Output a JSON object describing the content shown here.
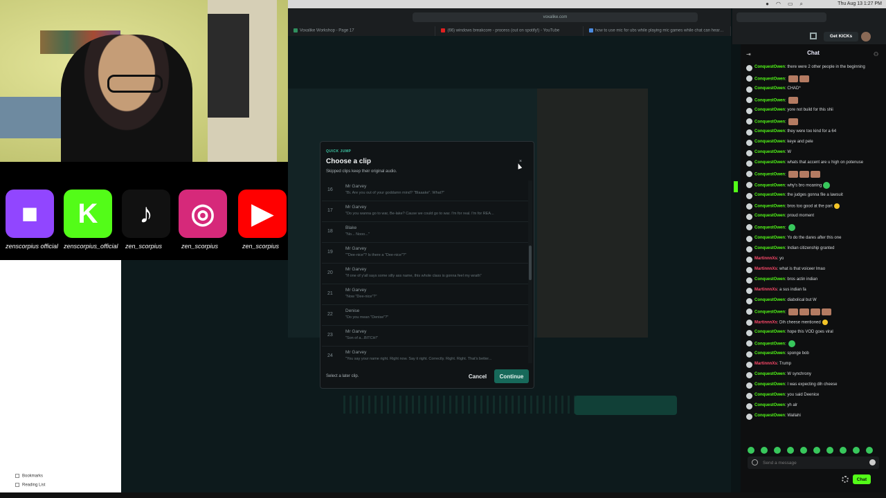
{
  "menubar": {
    "clock": "Thu Aug 13  1:27 PM"
  },
  "browser": {
    "url": "voxalike.com",
    "tabs": [
      {
        "label": "Voxalike Workshop - Page 17",
        "color": "#2f8f5e"
      },
      {
        "label": "(66) windows breakcore - process (out on spotify!) - YouTube",
        "color": "#e02020"
      },
      {
        "label": "how to use mic for ubs while playing mic games while chat can hear yo...",
        "color": "#4b8be0"
      }
    ]
  },
  "socials": [
    {
      "name": "twitch",
      "handle": "zenscorpius official",
      "color": "#9146ff",
      "glyph": "■"
    },
    {
      "name": "kick",
      "handle": "zenscorpius_official",
      "color": "#53fc18",
      "glyph": "K"
    },
    {
      "name": "tiktok",
      "handle": "zen_scorpius",
      "color": "#111",
      "glyph": "♪"
    },
    {
      "name": "instagram",
      "handle": "zen_scorpius",
      "color": "#d6297a",
      "glyph": "◎"
    },
    {
      "name": "youtube",
      "handle": "zen_scorpius",
      "color": "#ff0000",
      "glyph": "▶"
    }
  ],
  "sidebar": {
    "bookmarks": "Bookmarks",
    "reading_list": "Reading List"
  },
  "modal": {
    "kicker": "QUICK JUMP",
    "title": "Choose a clip",
    "subtitle": "Skipped clips keep their original audio.",
    "hint": "Select a later clip.",
    "cancel": "Cancel",
    "continue": "Continue",
    "clips": [
      {
        "num": "16",
        "speaker": "Mr Garvey",
        "line": "\"Bi. Are you out of your goddamn mind? \"Blaaake\". What?\""
      },
      {
        "num": "17",
        "speaker": "Mr Garvey",
        "line": "\"Do you wanna go to war, Be-lake? Cause we could go to war. I'm for real. I'm for REA..."
      },
      {
        "num": "18",
        "speaker": "Blake",
        "line": "\"No... Nooo...\""
      },
      {
        "num": "19",
        "speaker": "Mr Garvey",
        "line": "\"\"Dee-nice\"? Is there a \"Dee-nice\"?\""
      },
      {
        "num": "20",
        "speaker": "Mr Garvey",
        "line": "\"If one of y'all says some silly ass name, this whole class is gonna feel my wrath\""
      },
      {
        "num": "21",
        "speaker": "Mr Garvey",
        "line": "\"Now \"Dee-nice\"?\""
      },
      {
        "num": "22",
        "speaker": "Denise",
        "line": "\"Do you mean \"Denise\"?\""
      },
      {
        "num": "23",
        "speaker": "Mr Garvey",
        "line": "\"Son of a...BITCH!\""
      },
      {
        "num": "24",
        "speaker": "Mr Garvey",
        "line": "\"You say your name right. Right now. Say it right. Correctly. Right. Right. That's better..."
      }
    ]
  },
  "kick": {
    "get_kicks": "Get KICKs"
  },
  "chat": {
    "title": "Chat",
    "placeholder": "Send a message",
    "button": "Chat",
    "messages": [
      {
        "user": "ConquestOwen",
        "text": "there were 2 other people in the beginning",
        "red": false,
        "emote": ""
      },
      {
        "user": "ConquestOwen",
        "text": "",
        "red": false,
        "emote": "face2"
      },
      {
        "user": "ConquestOwen",
        "text": "CHAD*",
        "red": false,
        "emote": ""
      },
      {
        "user": "ConquestOwen",
        "text": "",
        "red": false,
        "emote": "face1"
      },
      {
        "user": "ConquestOwen",
        "text": "yore not build for this shii",
        "red": false,
        "emote": ""
      },
      {
        "user": "ConquestOwen",
        "text": "",
        "red": false,
        "emote": "face1"
      },
      {
        "user": "ConquestOwen",
        "text": "they were too kind for a 64",
        "red": false,
        "emote": ""
      },
      {
        "user": "ConquestOwen",
        "text": "keye and pele",
        "red": false,
        "emote": ""
      },
      {
        "user": "ConquestOwen",
        "text": "W",
        "red": false,
        "emote": ""
      },
      {
        "user": "ConquestOwen",
        "text": "whats that accent are u high on potenuse",
        "red": false,
        "emote": ""
      },
      {
        "user": "ConquestOwen",
        "text": "",
        "red": false,
        "emote": "face3"
      },
      {
        "user": "ConquestOwen",
        "text": "why's bro moaning",
        "red": false,
        "emote": "green"
      },
      {
        "user": "ConquestOwen",
        "text": "the judges gonna file a lawsuit",
        "red": false,
        "emote": ""
      },
      {
        "user": "ConquestOwen",
        "text": "bros too good at the part",
        "red": false,
        "emote": "yellow"
      },
      {
        "user": "ConquestOwen",
        "text": "proud moment",
        "red": false,
        "emote": ""
      },
      {
        "user": "ConquestOwen",
        "text": "",
        "red": false,
        "emote": "green"
      },
      {
        "user": "ConquestOwen",
        "text": "Yo do the dares after this one",
        "red": false,
        "emote": ""
      },
      {
        "user": "ConquestOwen",
        "text": "Indian citizenship granted",
        "red": false,
        "emote": ""
      },
      {
        "user": "MartinnnXs",
        "text": "yo",
        "red": true,
        "emote": ""
      },
      {
        "user": "MartinnnXs",
        "text": "what is that voiceer lmao",
        "red": true,
        "emote": ""
      },
      {
        "user": "ConquestOwen",
        "text": "bros actin indian",
        "red": false,
        "emote": ""
      },
      {
        "user": "MartinnnXs",
        "text": "a sus indian fa",
        "red": true,
        "emote": ""
      },
      {
        "user": "ConquestOwen",
        "text": "diabolical but W",
        "red": false,
        "emote": ""
      },
      {
        "user": "ConquestOwen",
        "text": "",
        "red": false,
        "emote": "face4"
      },
      {
        "user": "MartinnnXs",
        "text": "Dih cheese mentioned",
        "red": true,
        "emote": "yellow"
      },
      {
        "user": "ConquestOwen",
        "text": "hope this VOD goes viral",
        "red": false,
        "emote": ""
      },
      {
        "user": "ConquestOwen",
        "text": "",
        "red": false,
        "emote": "green"
      },
      {
        "user": "ConquestOwen",
        "text": "sponge bob",
        "red": false,
        "emote": ""
      },
      {
        "user": "MartinnnXs",
        "text": "Trump",
        "red": true,
        "emote": ""
      },
      {
        "user": "ConquestOwen",
        "text": "W synchrony",
        "red": false,
        "emote": ""
      },
      {
        "user": "ConquestOwen",
        "text": "I was expecting dih cheese",
        "red": false,
        "emote": ""
      },
      {
        "user": "ConquestOwen",
        "text": "you said Deenice",
        "red": false,
        "emote": ""
      },
      {
        "user": "ConquestOwen",
        "text": "yh alr",
        "red": false,
        "emote": ""
      },
      {
        "user": "ConquestOwen",
        "text": "Wallahi",
        "red": false,
        "emote": ""
      }
    ]
  }
}
